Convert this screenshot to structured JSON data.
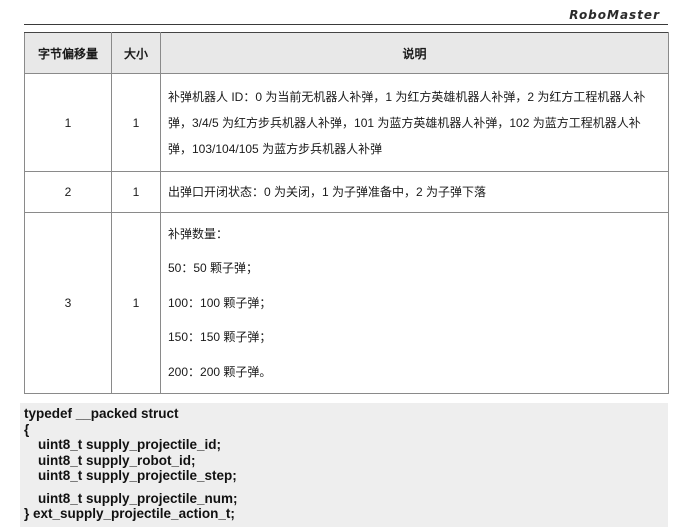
{
  "logo_text": "RoboMaster",
  "table": {
    "headers": [
      "字节偏移量",
      "大小",
      "说明"
    ],
    "rows": [
      {
        "offset": "1",
        "size": "1",
        "desc": [
          "补弹机器人 ID：0 为当前无机器人补弹，1 为红方英雄机器人补弹，2 为红方工程机器人补弹，3/4/5 为红方步兵机器人补弹，101 为蓝方英雄机器人补弹，102 为蓝方工程机器人补弹，103/104/105 为蓝方步兵机器人补弹"
        ]
      },
      {
        "offset": "2",
        "size": "1",
        "desc": [
          "出弹口开闭状态：0 为关闭，1 为子弹准备中，2 为子弹下落"
        ]
      },
      {
        "offset": "3",
        "size": "1",
        "desc": [
          "补弹数量：",
          "50：50 颗子弹；",
          "100：100 颗子弹；",
          "150：150 颗子弹；",
          "200：200 颗子弹。"
        ]
      }
    ]
  },
  "code": {
    "line1": "typedef __packed struct",
    "line2": "{",
    "line3": "uint8_t supply_projectile_id;",
    "line4": "uint8_t supply_robot_id;",
    "line5": "uint8_t supply_projectile_step;",
    "line6": "uint8_t supply_projectile_num;",
    "line7": "} ext_supply_projectile_action_t;"
  }
}
